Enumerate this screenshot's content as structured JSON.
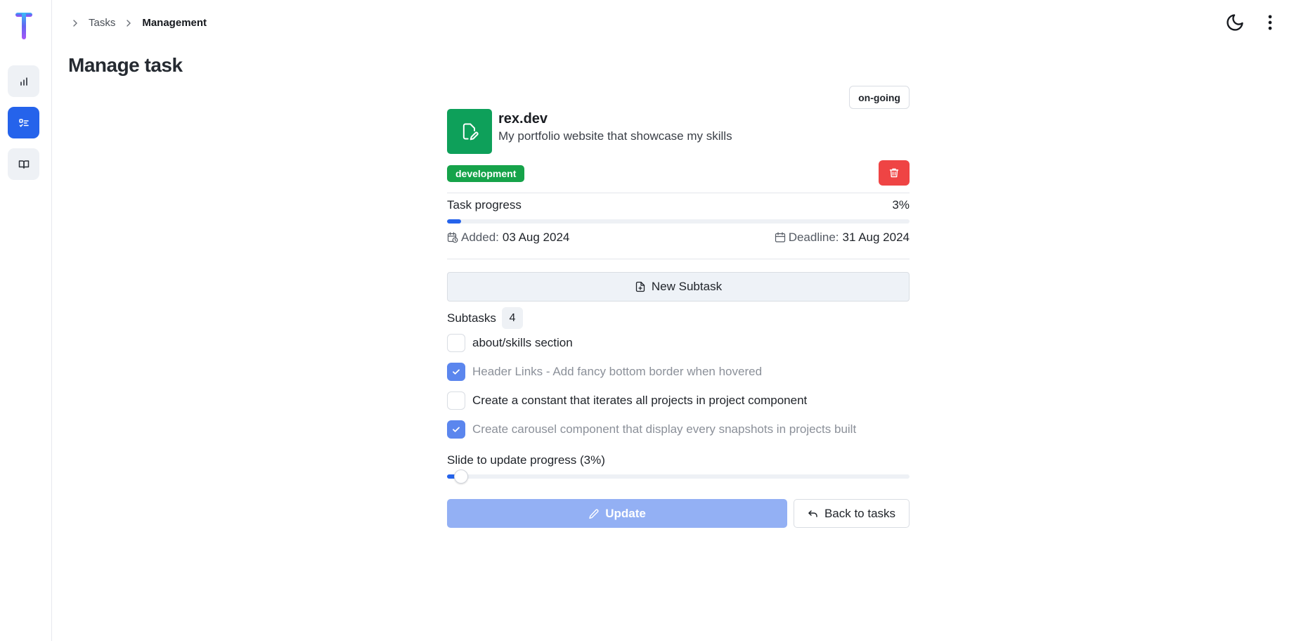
{
  "breadcrumb": [
    "Tasks",
    "Management"
  ],
  "page_title": "Manage task",
  "task": {
    "status": "on-going",
    "name": "rex.dev",
    "description": "My portfolio website that showcase my skills",
    "tag": "development",
    "progress_label": "Task progress",
    "progress_value": "3%",
    "progress_fraction": 0.03,
    "added_label": "Added:",
    "added_date": "03 Aug 2024",
    "deadline_label": "Deadline:",
    "deadline_date": "31 Aug 2024"
  },
  "new_subtask_label": "New Subtask",
  "subtasks": {
    "label": "Subtasks",
    "count": "4",
    "items": [
      {
        "text": "about/skills section",
        "checked": false
      },
      {
        "text": "Header Links - Add fancy bottom border when hovered",
        "checked": true
      },
      {
        "text": "Create a constant that iterates all projects in project component",
        "checked": false
      },
      {
        "text": "Create carousel component that display every snapshots in projects built",
        "checked": true
      }
    ]
  },
  "slider": {
    "label": "Slide to update progress (3%)",
    "value_fraction": 0.03
  },
  "buttons": {
    "update": "Update",
    "back": "Back to tasks"
  },
  "colors": {
    "accent": "#2563eb",
    "project_icon": "#0ea05a",
    "tag": "#16a34a",
    "danger": "#ef4444"
  },
  "icons": {
    "sidebar": [
      "bar-chart-icon",
      "task-list-icon",
      "book-icon"
    ],
    "top": [
      "moon-icon",
      "more-vertical-icon"
    ]
  }
}
